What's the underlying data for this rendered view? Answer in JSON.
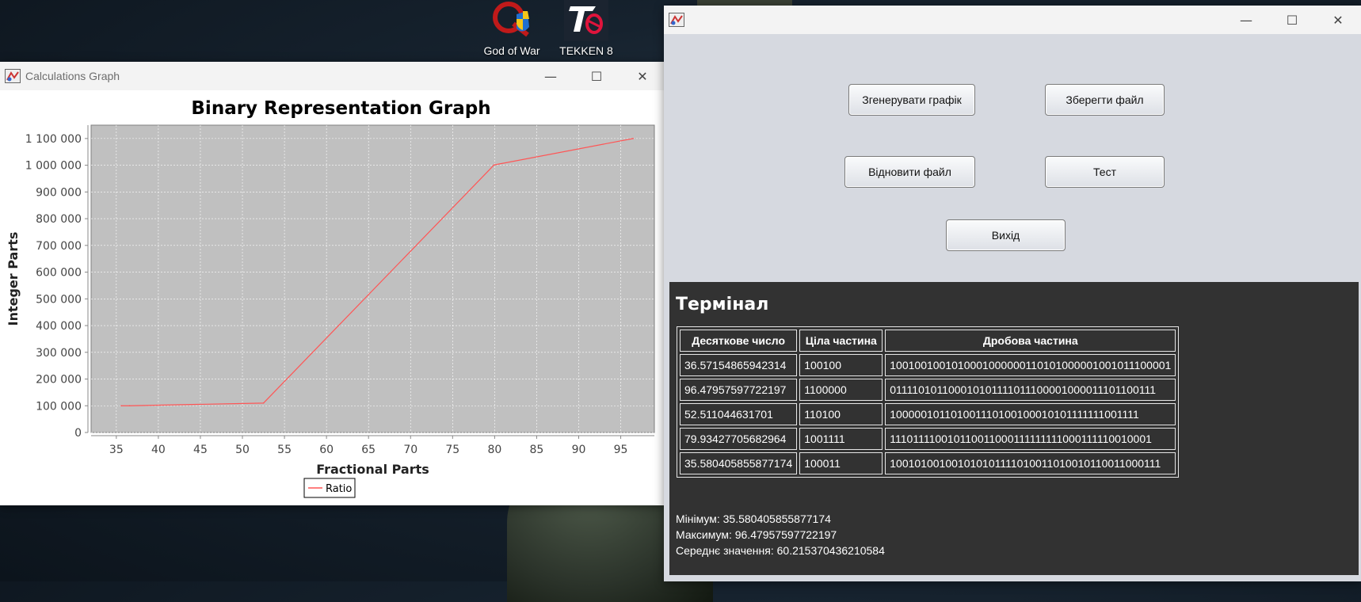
{
  "desktop": {
    "icons": [
      {
        "label": "God of War"
      },
      {
        "label": "TEKKEN 8"
      }
    ]
  },
  "graph_window": {
    "title": "Calculations Graph",
    "controls": {
      "minimize": "—",
      "maximize": "☐",
      "close": "✕"
    }
  },
  "chart_data": {
    "type": "line",
    "title": "Binary Representation Graph",
    "xlabel": "Fractional Parts",
    "ylabel": "Integer Parts",
    "xlim": [
      32,
      99
    ],
    "ylim": [
      0,
      1150000
    ],
    "x_ticks": [
      35,
      40,
      45,
      50,
      55,
      60,
      65,
      70,
      75,
      80,
      85,
      90,
      95
    ],
    "y_ticks": [
      0,
      100000,
      200000,
      300000,
      400000,
      500000,
      600000,
      700000,
      800000,
      900000,
      1000000,
      1100000
    ],
    "y_tick_labels": [
      "0",
      "100 000",
      "200 000",
      "300 000",
      "400 000",
      "500 000",
      "600 000",
      "700 000",
      "800 000",
      "900 000",
      "1 000 000",
      "1 100 000"
    ],
    "grid": true,
    "legend_position": "bottom",
    "series": [
      {
        "name": "Ratio",
        "color": "#ff5555",
        "points": [
          {
            "x": 35.580405855877174,
            "y": 100011
          },
          {
            "x": 36.57154865942314,
            "y": 100100
          },
          {
            "x": 52.511044631701,
            "y": 110100
          },
          {
            "x": 79.93427705682964,
            "y": 1001111
          },
          {
            "x": 96.47957597722197,
            "y": 1100000
          }
        ]
      }
    ]
  },
  "main_window": {
    "controls": {
      "minimize": "—",
      "maximize": "☐",
      "close": "✕"
    },
    "buttons": {
      "generate": "Згенерувати графік",
      "save": "Зберегти файл",
      "restore": "Відновити файл",
      "test": "Тест",
      "exit": "Вихід"
    },
    "terminal": {
      "title": "Термінал",
      "headers": [
        "Десяткове число",
        "Ціла частина",
        "Дробова частина"
      ],
      "rows": [
        [
          "36.57154865942314",
          "100100",
          "1001001001010001000000110101000001001011100001"
        ],
        [
          "96.47957597722197",
          "1100000",
          "011110101100010101111011100001000011101100111"
        ],
        [
          "52.511044631701",
          "110100",
          "100000101101001110100100010101111111001111"
        ],
        [
          "79.93427705682964",
          "1001111",
          "111011110010110011000111111111000111110010001"
        ],
        [
          "35.580405855877174",
          "100011",
          "100101001001010101111010011010010110011000111"
        ]
      ],
      "stats": {
        "min": "Мінімум: 35.580405855877174",
        "max": "Максимум: 96.47957597722197",
        "avg": "Середнє значення: 60.215370436210584"
      }
    }
  }
}
